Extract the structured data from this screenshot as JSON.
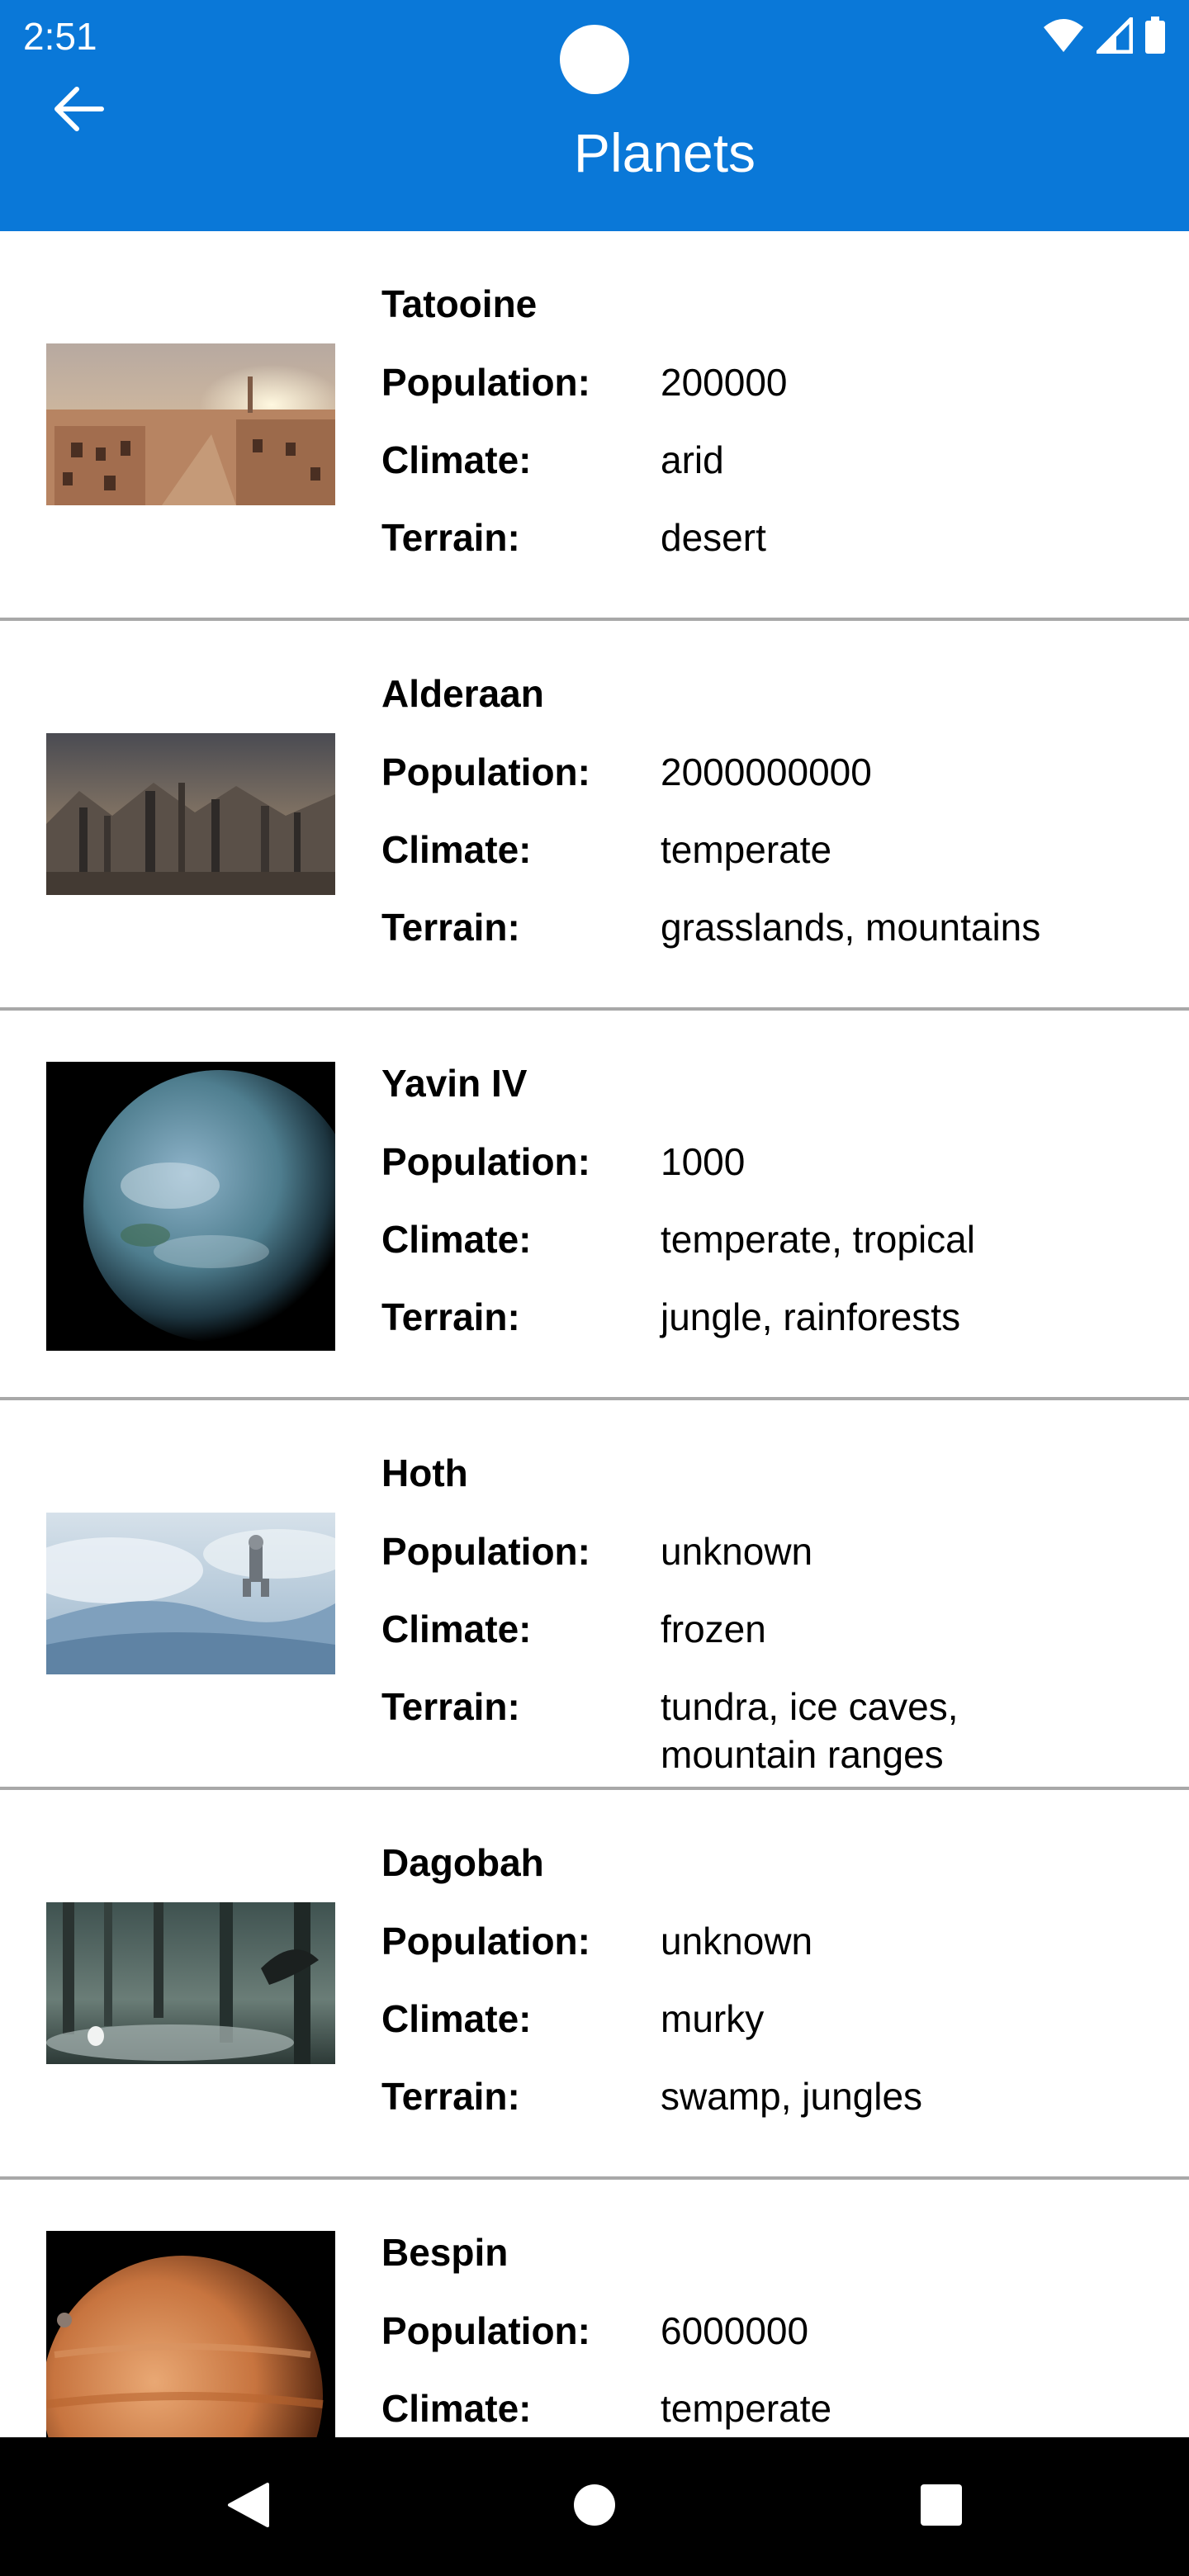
{
  "status_bar": {
    "time": "2:51",
    "icons": [
      "wifi-icon",
      "signal-icon",
      "battery-icon"
    ]
  },
  "app_bar": {
    "title": "Planets",
    "back_icon": "arrow-left-icon",
    "color": "#0a78d8"
  },
  "labels": {
    "population": "Population:",
    "climate": "Climate:",
    "terrain": "Terrain:"
  },
  "planets": [
    {
      "name": "Tatooine",
      "population": "200000",
      "climate": "arid",
      "terrain": "desert"
    },
    {
      "name": "Alderaan",
      "population": "2000000000",
      "climate": "temperate",
      "terrain": "grasslands, mountains"
    },
    {
      "name": "Yavin IV",
      "population": "1000",
      "climate": "temperate, tropical",
      "terrain": "jungle, rainforests"
    },
    {
      "name": "Hoth",
      "population": "unknown",
      "climate": "frozen",
      "terrain": "tundra, ice caves,\nmountain ranges"
    },
    {
      "name": "Dagobah",
      "population": "unknown",
      "climate": "murky",
      "terrain": "swamp, jungles"
    },
    {
      "name": "Bespin",
      "population": "6000000",
      "climate": "temperate",
      "terrain": ""
    }
  ],
  "nav_bar": {
    "icons": [
      "nav-back-icon",
      "nav-home-icon",
      "nav-recents-icon"
    ]
  }
}
